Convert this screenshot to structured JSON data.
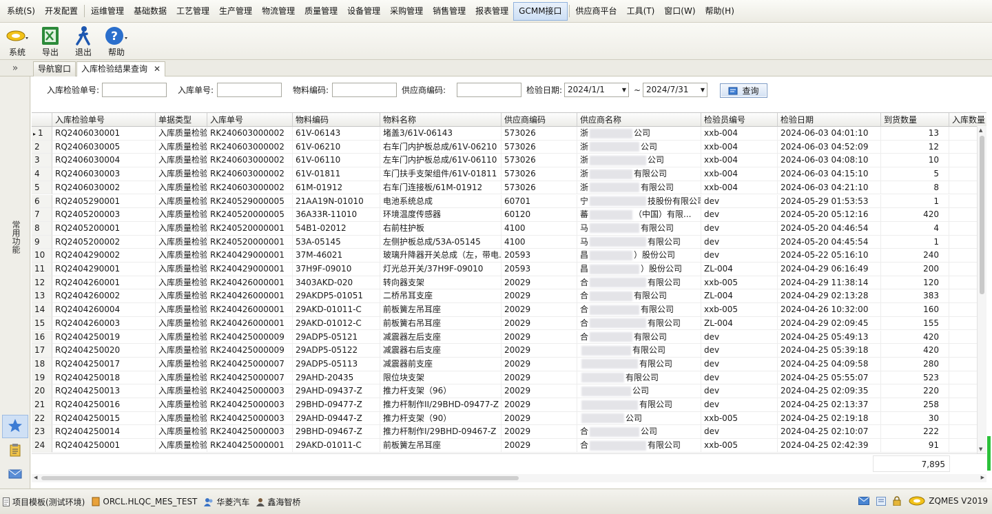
{
  "menu": {
    "items": [
      "系统(S)",
      "开发配置",
      "运维管理",
      "基础数据",
      "工艺管理",
      "生产管理",
      "物流管理",
      "质量管理",
      "设备管理",
      "采购管理",
      "销售管理",
      "报表管理",
      "GCMM接口",
      "供应商平台",
      "工具(T)",
      "窗口(W)",
      "帮助(H)"
    ],
    "active": "GCMM接口"
  },
  "toolbar": {
    "system_label": "系统",
    "export_label": "导出",
    "exit_label": "退出",
    "help_label": "帮助"
  },
  "sidebar": {
    "collapse_glyph": "»",
    "vertical_label": "常用功能"
  },
  "tabs": {
    "nav": "导航窗口",
    "query": "入库检验结果查询",
    "close_glyph": "✕"
  },
  "filters": {
    "inspection_no_label": "入库检验单号:",
    "receipt_no_label": "入库单号:",
    "material_code_label": "物料编码:",
    "supplier_code_label": "供应商编码:",
    "date_label": "检验日期:",
    "date_from": "2024/1/1",
    "date_sep": "~",
    "date_to": "2024/7/31",
    "query_button": "查询"
  },
  "grid": {
    "columns": [
      "入库检验单号",
      "单据类型",
      "入库单号",
      "物料编码",
      "物料名称",
      "供应商编码",
      "供应商名称",
      "检验员编号",
      "检验日期",
      "到货数量",
      "入库数量"
    ],
    "rows": [
      [
        "1",
        "RQ2406030001",
        "入库质量检验",
        "RK240603000002",
        "61V-06143",
        "堵盖3/61V-06143",
        "573026",
        "浙",
        "公司",
        "xxb-004",
        "2024-06-03 04:01:10",
        "13"
      ],
      [
        "2",
        "RQ2406030005",
        "入库质量检验",
        "RK240603000002",
        "61V-06210",
        "右车门内护板总成/61V-06210",
        "573026",
        "浙",
        "公司",
        "xxb-004",
        "2024-06-03 04:52:09",
        "12"
      ],
      [
        "3",
        "RQ2406030004",
        "入库质量检验",
        "RK240603000002",
        "61V-06110",
        "左车门内护板总成/61V-06110",
        "573026",
        "浙",
        "公司",
        "xxb-004",
        "2024-06-03 04:08:10",
        "10"
      ],
      [
        "4",
        "RQ2406030003",
        "入库质量检验",
        "RK240603000002",
        "61V-01811",
        "车门扶手支架组件/61V-01811",
        "573026",
        "浙",
        "有限公司",
        "xxb-004",
        "2024-06-03 04:15:10",
        "5"
      ],
      [
        "5",
        "RQ2406030002",
        "入库质量检验",
        "RK240603000002",
        "61M-01912",
        "右车门连接板/61M-01912",
        "573026",
        "浙",
        "有限公司",
        "xxb-004",
        "2024-06-03 04:21:10",
        "8"
      ],
      [
        "6",
        "RQ2405290001",
        "入库质量检验",
        "RK240529000005",
        "21AA19N-01010",
        "电池系统总成",
        "60701",
        "宁",
        "技股份有限公司",
        "dev",
        "2024-05-29 01:53:53",
        "1"
      ],
      [
        "7",
        "RQ2405200003",
        "入库质量检验",
        "RK240520000005",
        "36A33R-11010",
        "环境温度传感器",
        "60120",
        "蕃",
        "（中国）有限...",
        "dev",
        "2024-05-20 05:12:16",
        "420"
      ],
      [
        "8",
        "RQ2405200001",
        "入库质量检验",
        "RK240520000001",
        "54B1-02012",
        "右前柱护板",
        "4100",
        "马",
        "有限公司",
        "dev",
        "2024-05-20 04:46:54",
        "4"
      ],
      [
        "9",
        "RQ2405200002",
        "入库质量检验",
        "RK240520000001",
        "53A-05145",
        "左侧护板总成/53A-05145",
        "4100",
        "马",
        "有限公司",
        "dev",
        "2024-05-20 04:45:54",
        "1"
      ],
      [
        "10",
        "RQ2404290002",
        "入库质量检验",
        "RK240429000001",
        "37M-46021",
        "玻璃升降器开关总成（左，带电...",
        "20593",
        "昌",
        "）股份公司",
        "dev",
        "2024-05-22 05:16:10",
        "240"
      ],
      [
        "11",
        "RQ2404290001",
        "入库质量检验",
        "RK240429000001",
        "37H9F-09010",
        "灯光总开关/37H9F-09010",
        "20593",
        "昌",
        "）股份公司",
        "ZL-004",
        "2024-04-29 06:16:49",
        "200"
      ],
      [
        "12",
        "RQ2404260001",
        "入库质量检验",
        "RK240426000001",
        "3403AKD-020",
        "转向器支架",
        "20029",
        "合",
        "有限公司",
        "xxb-005",
        "2024-04-29 11:38:14",
        "120"
      ],
      [
        "13",
        "RQ2404260002",
        "入库质量检验",
        "RK240426000001",
        "29AKDP5-01051",
        "二桥吊耳支座",
        "20029",
        "合",
        "有限公司",
        "ZL-004",
        "2024-04-29 02:13:28",
        "383"
      ],
      [
        "14",
        "RQ2404260004",
        "入库质量检验",
        "RK240426000001",
        "29AKD-01011-C",
        "前板簧左吊耳座",
        "20029",
        "合",
        "有限公司",
        "xxb-005",
        "2024-04-26 10:32:00",
        "160"
      ],
      [
        "15",
        "RQ2404260003",
        "入库质量检验",
        "RK240426000001",
        "29AKD-01012-C",
        "前板簧右吊耳座",
        "20029",
        "合",
        "有限公司",
        "ZL-004",
        "2024-04-29 02:09:45",
        "155"
      ],
      [
        "16",
        "RQ2404250019",
        "入库质量检验",
        "RK240425000009",
        "29ADP5-05121",
        "减震器左后支座",
        "20029",
        "合",
        "有限公司",
        "dev",
        "2024-04-25 05:49:13",
        "420"
      ],
      [
        "17",
        "RQ2404250020",
        "入库质量检验",
        "RK240425000009",
        "29ADP5-05122",
        "减震器右后支座",
        "20029",
        "",
        "有限公司",
        "dev",
        "2024-04-25 05:39:18",
        "420"
      ],
      [
        "18",
        "RQ2404250017",
        "入库质量检验",
        "RK240425000007",
        "29ADP5-05113",
        "减震器前支座",
        "20029",
        "",
        "有限公司",
        "dev",
        "2024-04-25 04:09:58",
        "280"
      ],
      [
        "19",
        "RQ2404250018",
        "入库质量检验",
        "RK240425000007",
        "29AHD-20435",
        "限位块支架",
        "20029",
        "",
        "有限公司",
        "dev",
        "2024-04-25 05:55:07",
        "523"
      ],
      [
        "20",
        "RQ2404250013",
        "入库质量检验",
        "RK240425000003",
        "29AHD-09437-Z",
        "推力杆支架（96）",
        "20029",
        "",
        "公司",
        "dev",
        "2024-04-25 02:09:35",
        "220"
      ],
      [
        "21",
        "RQ2404250016",
        "入库质量检验",
        "RK240425000003",
        "29BHD-09477-Z",
        "推力杆制作II/29BHD-09477-Z",
        "20029",
        "",
        "有限公司",
        "dev",
        "2024-04-25 02:13:37",
        "258"
      ],
      [
        "22",
        "RQ2404250015",
        "入库质量检验",
        "RK240425000003",
        "29AHD-09447-Z",
        "推力杆支架（90）",
        "20029",
        "",
        "公司",
        "xxb-005",
        "2024-04-25 02:19:18",
        "30"
      ],
      [
        "23",
        "RQ2404250014",
        "入库质量检验",
        "RK240425000003",
        "29BHD-09467-Z",
        "推力杆制作I/29BHD-09467-Z",
        "20029",
        "合",
        "公司",
        "dev",
        "2024-04-25 02:10:07",
        "222"
      ],
      [
        "24",
        "RQ2404250001",
        "入库质量检验",
        "RK240425000001",
        "29AKD-01011-C",
        "前板簧左吊耳座",
        "20029",
        "合",
        "有限公司",
        "xxb-005",
        "2024-04-25 02:42:39",
        "91"
      ]
    ],
    "selected_marker": "▸",
    "total": "7,895"
  },
  "status": {
    "template": "项目模板(测试环境)",
    "database": "ORCL.HLQC_MES_TEST",
    "company": "华菱汽车",
    "user": "鑫海智桥",
    "version": "ZQMES V2019"
  },
  "colors": {
    "accent": "#2e6fc9",
    "active_menu": "#cddff5"
  },
  "icons": [
    "system-icon",
    "export-icon",
    "exit-icon",
    "help-icon",
    "star-icon",
    "clipboard-icon",
    "mail-icon",
    "lock-icon",
    "info-icon",
    "logo-icon"
  ]
}
